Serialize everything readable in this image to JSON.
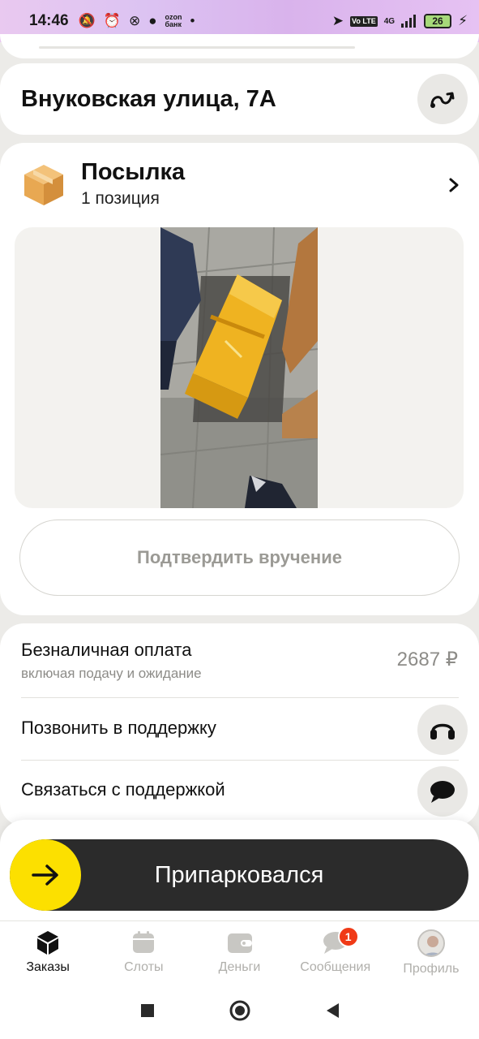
{
  "status_bar": {
    "time": "14:46",
    "ozon_label_1": "ozon",
    "ozon_label_2": "банк",
    "volte": "Vo LTE",
    "network": "4G",
    "battery": "26"
  },
  "address": {
    "text": "Внуковская улица, 7А",
    "route_icon": "route-icon"
  },
  "parcel": {
    "title": "Посылка",
    "subtitle": "1 позиция",
    "confirm_label": "Подтвердить вручение"
  },
  "payment": {
    "title": "Безналичная оплата",
    "subtitle": "включая подачу и ожидание",
    "price": "2687 ₽"
  },
  "support": {
    "call_label": "Позвонить в поддержку",
    "chat_label": "Связаться с поддержкой"
  },
  "action": {
    "label": "Припарковался"
  },
  "tabs": [
    {
      "label": "Заказы",
      "icon": "box-icon",
      "active": true
    },
    {
      "label": "Слоты",
      "icon": "calendar-icon",
      "active": false
    },
    {
      "label": "Деньги",
      "icon": "wallet-icon",
      "active": false
    },
    {
      "label": "Сообщения",
      "icon": "chat-icon",
      "active": false,
      "badge": "1"
    },
    {
      "label": "Профиль",
      "icon": "avatar",
      "active": false
    }
  ],
  "colors": {
    "accent_yellow": "#fce000",
    "dark_button": "#2b2b2b",
    "badge_red": "#f03a17"
  }
}
